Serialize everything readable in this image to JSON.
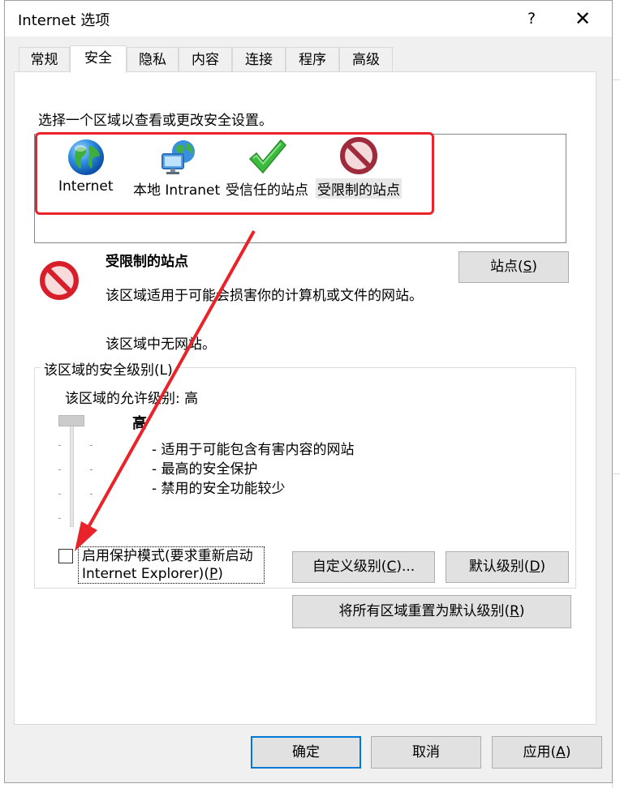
{
  "window": {
    "title": "Internet 选项",
    "help": "?",
    "close": "✕"
  },
  "tabs": [
    {
      "label": "常规"
    },
    {
      "label": "安全"
    },
    {
      "label": "隐私"
    },
    {
      "label": "内容"
    },
    {
      "label": "连接"
    },
    {
      "label": "程序"
    },
    {
      "label": "高级"
    }
  ],
  "active_tab": "安全",
  "zones": {
    "instruction": "选择一个区域以查看或更改安全设置。",
    "items": [
      {
        "label": "Internet",
        "icon": "globe-icon"
      },
      {
        "label": "本地 Intranet",
        "icon": "intranet-icon"
      },
      {
        "label": "受信任的站点",
        "icon": "checkmark-icon"
      },
      {
        "label": "受限制的站点",
        "icon": "restricted-icon",
        "selected": true
      }
    ]
  },
  "selected_zone": {
    "name": "受限制的站点",
    "description": "该区域适用于可能会损害你的计算机或文件的网站。",
    "sites_info": "该区域中无网站。",
    "sites_button_prefix": "站点(",
    "sites_button_key": "S",
    "sites_button_suffix": ")"
  },
  "security_level": {
    "group_title": "该区域的安全级别(L)",
    "allowed_level": "该区域的允许级别: 高",
    "level_name": "高",
    "bullets": [
      "- 适用于可能包含有害内容的网站",
      "- 最高的安全保护",
      "- 禁用的安全功能较少"
    ],
    "protected_mode_line1": "启用保护模式(要求重新启动",
    "protected_mode_line2_prefix": "Internet Explorer)(",
    "protected_mode_line2_key": "P",
    "protected_mode_line2_suffix": ")",
    "protected_mode_checked": false,
    "custom_button_prefix": "自定义级别(",
    "custom_button_key": "C",
    "custom_button_suffix": ")...",
    "default_button_prefix": "默认级别(",
    "default_button_key": "D",
    "default_button_suffix": ")"
  },
  "reset_button_prefix": "将所有区域重置为默认级别(",
  "reset_button_key": "R",
  "reset_button_suffix": ")",
  "footer": {
    "ok": "确定",
    "cancel": "取消",
    "apply_prefix": "应用(",
    "apply_key": "A",
    "apply_suffix": ")"
  },
  "colors": {
    "annotation_red": "#e8232a",
    "accent_blue": "#0078d7",
    "dialog_bg": "#f0f0f0"
  }
}
